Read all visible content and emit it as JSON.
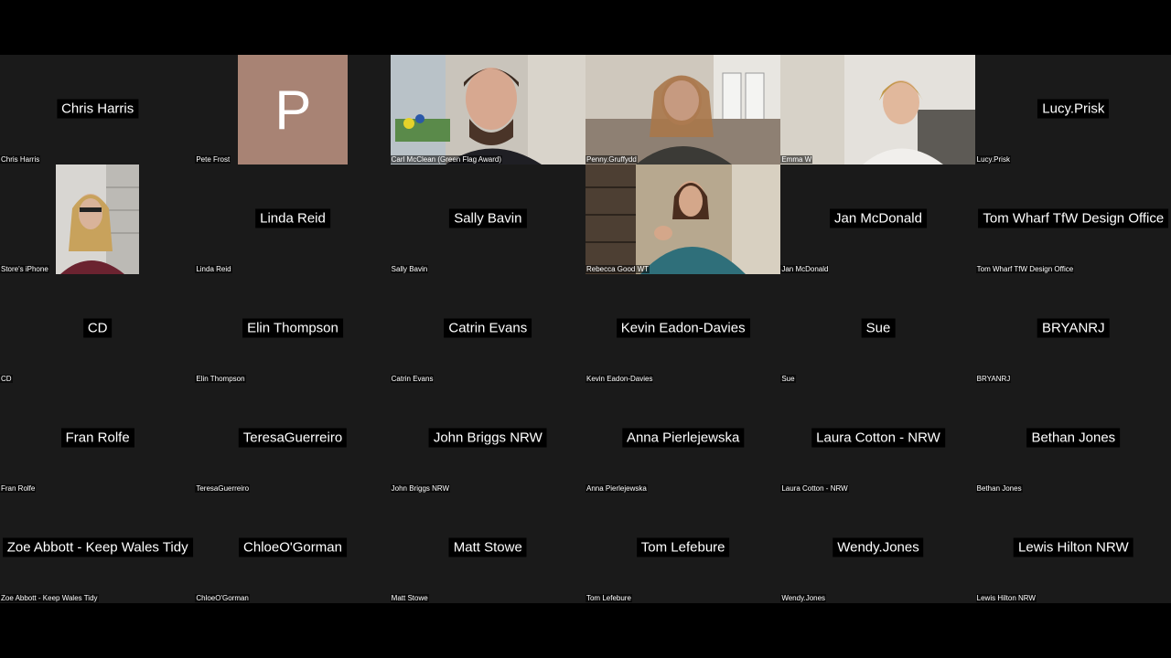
{
  "colors": {
    "background": "#000000",
    "tile": "#1a1a1a",
    "avatar_p": "#a88374"
  },
  "avatar_letter": "P",
  "participants": [
    {
      "name": "Chris Harris",
      "label": "Chris Harris",
      "has_video": false
    },
    {
      "name": "Pete Frost",
      "label": "Pete Frost",
      "has_video": false,
      "avatar": "P"
    },
    {
      "name": "Carl McClean (Green Flag Award)",
      "label": "Carl McClean (Green Flag Award)",
      "has_video": true
    },
    {
      "name": "Penny.Gruffydd",
      "label": "Penny.Gruffydd",
      "has_video": true
    },
    {
      "name": "Emma W",
      "label": "Emma W",
      "has_video": true
    },
    {
      "name": "Lucy.Prisk",
      "label": "Lucy.Prisk",
      "has_video": false
    },
    {
      "name": "Store's iPhone",
      "label": "Store's iPhone",
      "has_video": true
    },
    {
      "name": "Linda Reid",
      "label": "Linda Reid",
      "has_video": false
    },
    {
      "name": "Sally Bavin",
      "label": "Sally Bavin",
      "has_video": false
    },
    {
      "name": "Rebecca Good WT",
      "label": "Rebecca Good WT",
      "has_video": true
    },
    {
      "name": "Jan McDonald",
      "label": "Jan McDonald",
      "has_video": false
    },
    {
      "name": "Tom Wharf TfW Design Office",
      "label": "Tom Wharf TfW Design Office",
      "has_video": false
    },
    {
      "name": "CD",
      "label": "CD",
      "has_video": false
    },
    {
      "name": "Elin Thompson",
      "label": "Elin Thompson",
      "has_video": false
    },
    {
      "name": "Catrin Evans",
      "label": "Catrin Evans",
      "has_video": false
    },
    {
      "name": "Kevin Eadon-Davies",
      "label": "Kevin Eadon-Davies",
      "has_video": false
    },
    {
      "name": "Sue",
      "label": "Sue",
      "has_video": false
    },
    {
      "name": "BRYANRJ",
      "label": "BRYANRJ",
      "has_video": false
    },
    {
      "name": "Fran Rolfe",
      "label": "Fran Rolfe",
      "has_video": false
    },
    {
      "name": "TeresaGuerreiro",
      "label": "TeresaGuerreiro",
      "has_video": false
    },
    {
      "name": "John Briggs NRW",
      "label": "John Briggs NRW",
      "has_video": false
    },
    {
      "name": "Anna Pierlejewska",
      "label": "Anna Pierlejewska",
      "has_video": false
    },
    {
      "name": "Laura Cotton - NRW",
      "label": "Laura Cotton - NRW",
      "has_video": false
    },
    {
      "name": "Bethan Jones",
      "label": "Bethan Jones",
      "has_video": false
    },
    {
      "name": "Zoe Abbott - Keep Wales Tidy",
      "label": "Zoe Abbott - Keep Wales Tidy",
      "has_video": false
    },
    {
      "name": "ChloeO'Gorman",
      "label": "ChloeO'Gorman",
      "has_video": false
    },
    {
      "name": "Matt Stowe",
      "label": "Matt Stowe",
      "has_video": false
    },
    {
      "name": "Tom Lefebure",
      "label": "Tom Lefebure",
      "has_video": false
    },
    {
      "name": "Wendy.Jones",
      "label": "Wendy.Jones",
      "has_video": false
    },
    {
      "name": "Lewis Hilton NRW",
      "label": "Lewis Hilton NRW",
      "has_video": false
    }
  ]
}
